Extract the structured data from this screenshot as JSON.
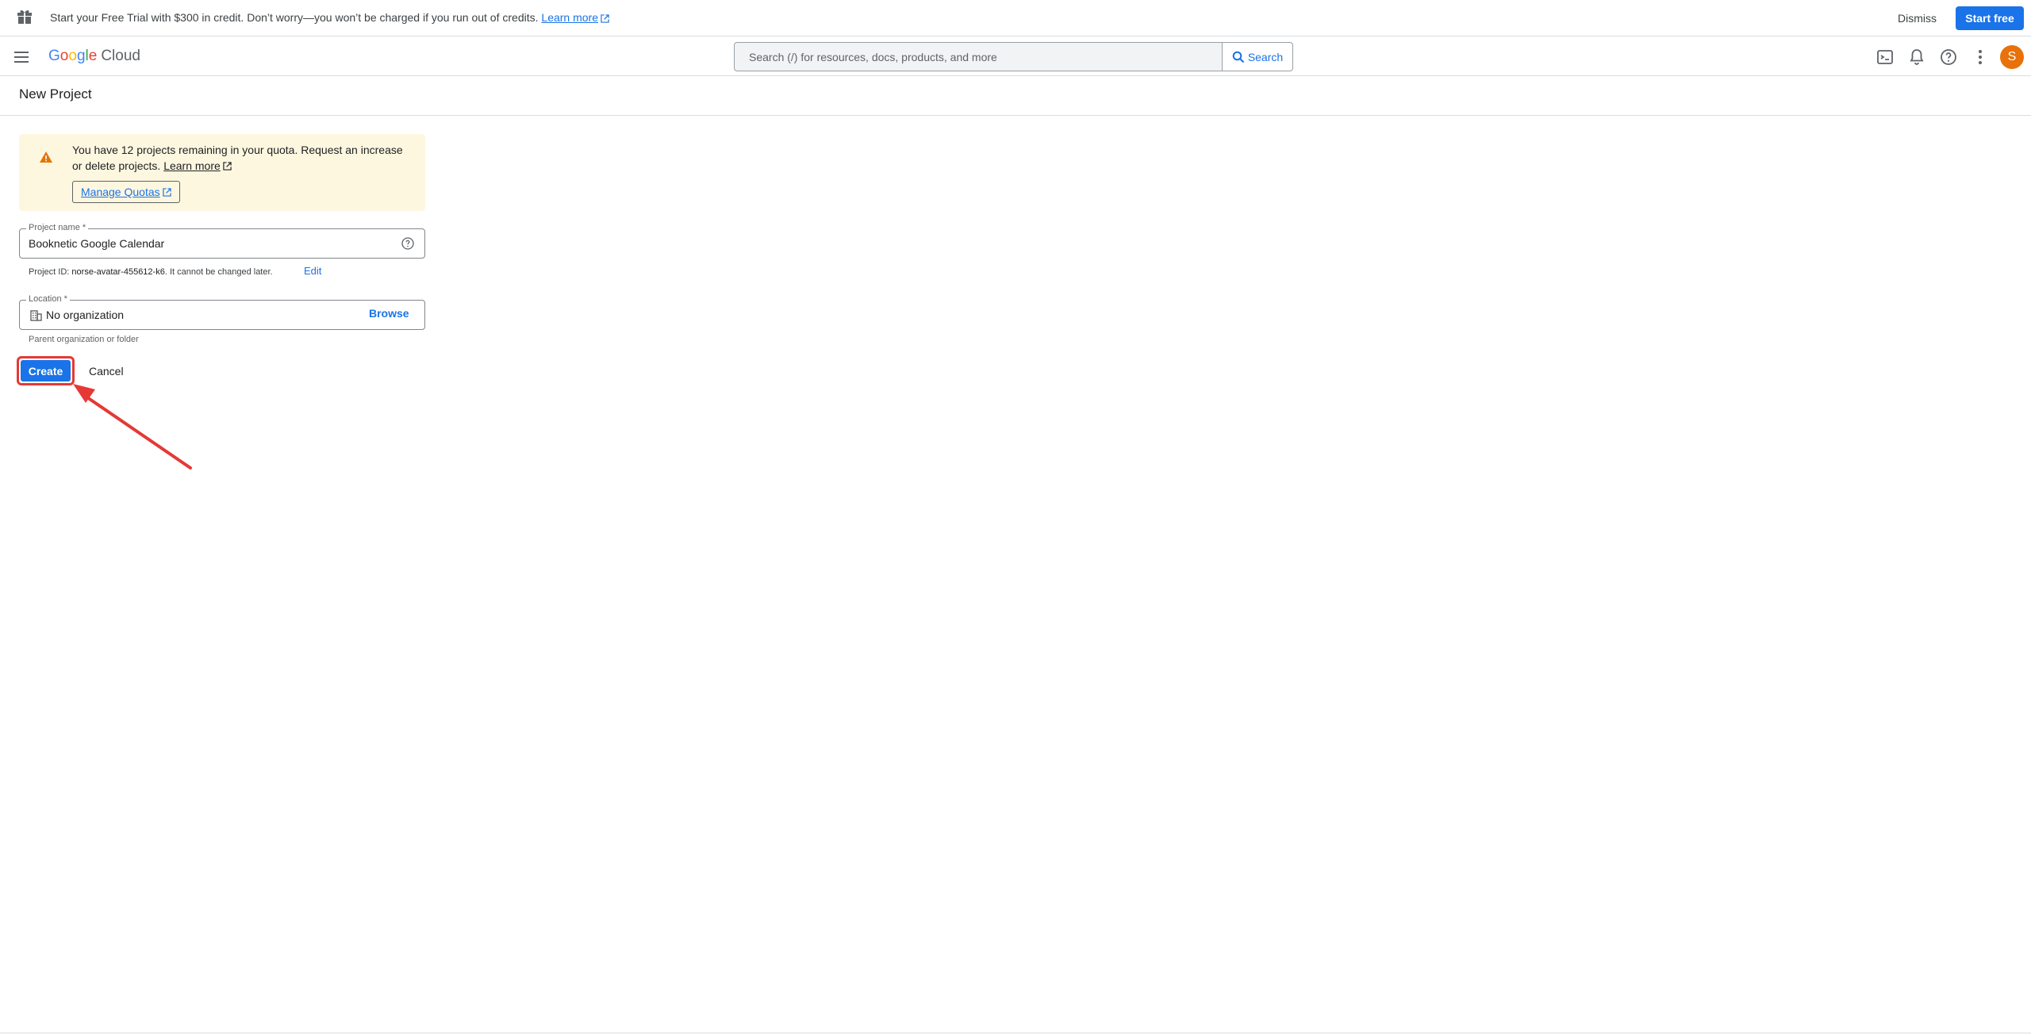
{
  "banner": {
    "message": "Start your Free Trial with $300 in credit. Don’t worry—you won’t be charged if you run out of credits.",
    "learn_more": "Learn more",
    "dismiss": "Dismiss",
    "start_free": "Start free"
  },
  "header": {
    "logo_letters": [
      "G",
      "o",
      "o",
      "g",
      "l",
      "e"
    ],
    "logo_product": "Cloud",
    "search_placeholder": "Search (/) for resources, docs, products, and more",
    "search_button": "Search",
    "avatar_initial": "S"
  },
  "page": {
    "title": "New Project"
  },
  "quota_warning": {
    "text": "You have 12 projects remaining in your quota. Request an increase or delete projects.",
    "learn_more": "Learn more",
    "manage_quotas": "Manage Quotas"
  },
  "form": {
    "project_name_label": "Project name *",
    "project_name_value": "Booknetic Google Calendar",
    "project_id_prefix": "Project ID:",
    "project_id_value": "norse-avatar-455612-k6",
    "project_id_suffix": ". It cannot be changed later.",
    "edit": "Edit",
    "location_label": "Location *",
    "location_value": "No organization",
    "browse": "Browse",
    "location_hint": "Parent organization or folder",
    "create": "Create",
    "cancel": "Cancel"
  },
  "colors": {
    "accent": "#1a73e8",
    "warning_bg": "#fef7e0",
    "warning_icon": "#e37400",
    "highlight": "#e53935",
    "avatar": "#e8710a"
  }
}
